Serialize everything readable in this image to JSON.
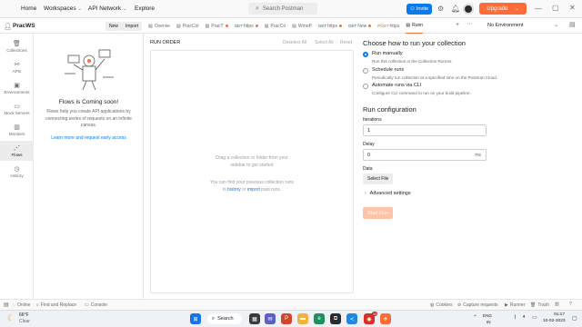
{
  "topbar": {
    "nav": [
      "Home",
      "Workspaces",
      "API Network",
      "Explore"
    ],
    "search_placeholder": "Search Postman",
    "invite_label": "Invite",
    "upgrade_label": "Upgrade"
  },
  "workspace": {
    "name": "PracWS",
    "new_label": "New",
    "import_label": "Import"
  },
  "tabs": [
    {
      "label": "Overvie",
      "method": ""
    },
    {
      "label": "PracCol",
      "method": ""
    },
    {
      "label": "PracT",
      "method": ""
    },
    {
      "label": "https",
      "method": "GET"
    },
    {
      "label": "PracCo",
      "method": ""
    },
    {
      "label": "WmoP",
      "method": ""
    },
    {
      "label": "https",
      "method": "GET"
    },
    {
      "label": "New",
      "method": "GET"
    },
    {
      "label": "https",
      "method": "POST"
    },
    {
      "label": "Runn",
      "method": ""
    }
  ],
  "environment": "No Environment",
  "rail": [
    {
      "label": "Collections",
      "icon": "collections-icon"
    },
    {
      "label": "APIs",
      "icon": "apis-icon"
    },
    {
      "label": "Environments",
      "icon": "environments-icon"
    },
    {
      "label": "Mock Servers",
      "icon": "mock-servers-icon"
    },
    {
      "label": "Monitors",
      "icon": "monitors-icon"
    },
    {
      "label": "Flows",
      "icon": "flows-icon"
    },
    {
      "label": "History",
      "icon": "history-icon"
    }
  ],
  "flows_panel": {
    "title": "Flows is Coming soon!",
    "body": "Flows help you create API applications by connecting series of requests on an infinite canvas.",
    "link": "Learn more and request early access"
  },
  "run_order": {
    "title": "RUN ORDER",
    "deselect_all": "Deselect All",
    "select_all": "Select All",
    "reset": "Reset",
    "empty_line1": "Drag a collection or folder from your",
    "empty_line2": "sidebar to get started",
    "hint_line1": "You can find your previous collection runs",
    "hint_in": "in",
    "hint_history": "history",
    "hint_or": "or",
    "hint_import": "import",
    "hint_end": "past runs."
  },
  "run_options": {
    "heading": "Choose how to run your collection",
    "options": [
      {
        "title": "Run manually",
        "desc": "Run this collection in the Collection Runner.",
        "selected": true
      },
      {
        "title": "Schedule runs",
        "desc": "Periodically run collection at a specified time on the Postman Cloud.",
        "selected": false
      },
      {
        "title": "Automate runs via CLI",
        "desc": "Configure CLI command to run on your build pipeline.",
        "selected": false
      }
    ]
  },
  "run_config": {
    "heading": "Run configuration",
    "iterations_label": "Iterations",
    "iterations_value": "1",
    "delay_label": "Delay",
    "delay_value": "0",
    "delay_unit": "ms",
    "data_label": "Data",
    "select_file": "Select File",
    "advanced": "Advanced settings",
    "start_run": "Start Run"
  },
  "statusbar": {
    "online": "Online",
    "find_replace": "Find and Replace",
    "console": "Console",
    "cookies": "Cookies",
    "capture": "Capture requests",
    "runner": "Runner",
    "trash": "Trash"
  },
  "taskbar": {
    "temp": "66°F",
    "weather": "Clear",
    "search": "Search",
    "lang1": "ENG",
    "lang2": "IN",
    "time": "01:17",
    "date": "10-02-2023",
    "badge": "10"
  },
  "colors": {
    "accent_blue": "#097bed",
    "orange": "#ff6c37"
  }
}
